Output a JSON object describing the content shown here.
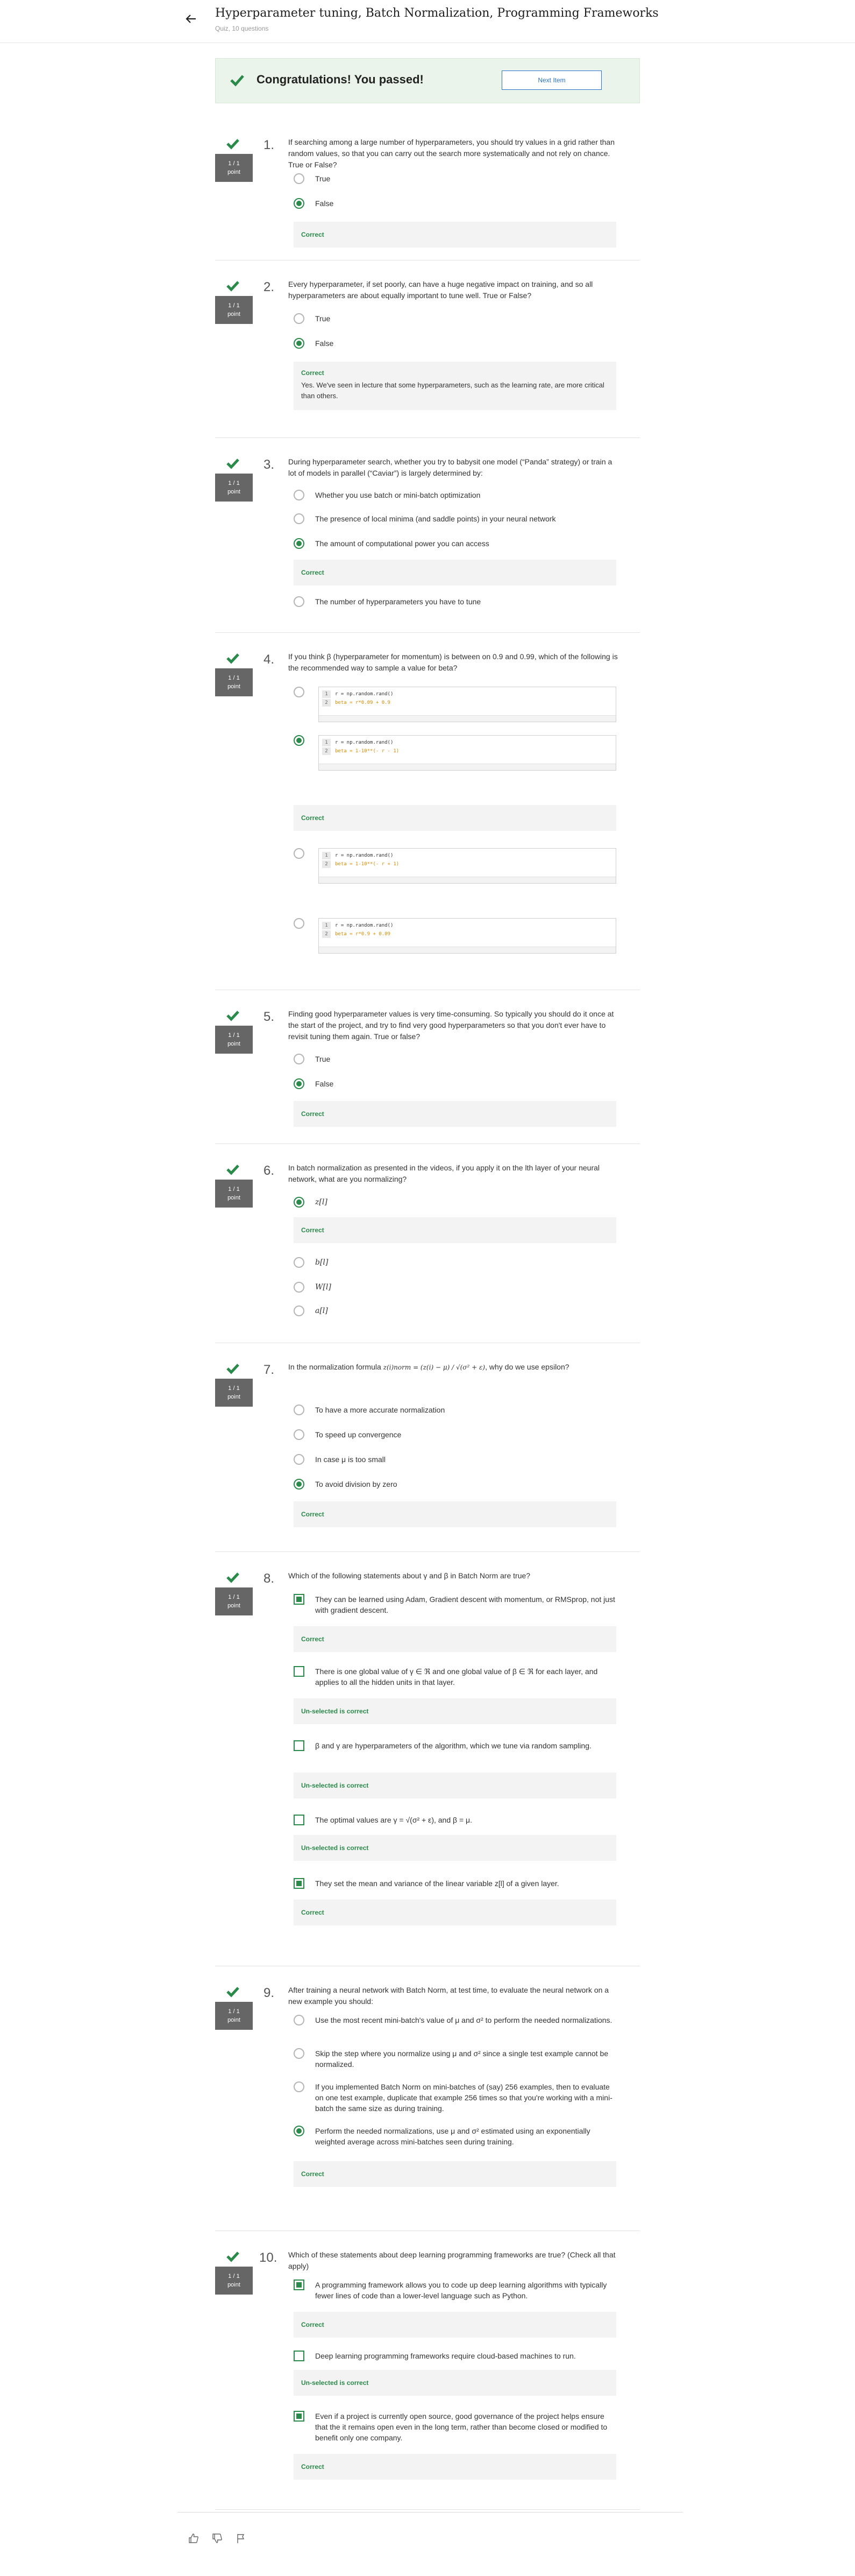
{
  "header": {
    "title": "Hyperparameter tuning, Batch Normalization, Programming Frameworks",
    "subtitle": "Quiz, 10 questions"
  },
  "banner": {
    "message": "Congratulations! You passed!",
    "next_label": "Next Item"
  },
  "points": {
    "score": "1 / 1",
    "unit": "point"
  },
  "colors": {
    "accent_green": "#2a8a4a",
    "link_blue": "#2a73cc"
  },
  "questions": [
    {
      "number": "1.",
      "text": "If searching among a large number of hyperparameters, you should try values in a grid rather than random values, so that you can carry out the search more systematically and not rely on chance. True or False?",
      "options": [
        "True",
        "False"
      ],
      "feedback": "Correct"
    },
    {
      "number": "2.",
      "text": "Every hyperparameter, if set poorly, can have a huge negative impact on training, and so all hyperparameters are about equally important to tune well. True or False?",
      "options": [
        "True",
        "False"
      ],
      "feedback": "Correct",
      "explanation": "Yes. We've seen in lecture that some hyperparameters, such as the learning rate, are more critical than others."
    },
    {
      "number": "3.",
      "text": "During hyperparameter search, whether you try to babysit one model (“Panda” strategy) or train a lot of models in parallel (“Caviar”) is largely determined by:",
      "options": [
        "Whether you use batch or mini-batch optimization",
        "The presence of local minima (and saddle points) in your neural network",
        "The amount of computational power you can access",
        "The number of hyperparameters you have to tune"
      ],
      "feedback": "Correct"
    },
    {
      "number": "4.",
      "text": "If you think β (hyperparameter for momentum) is between on 0.9 and 0.99, which of the following is the recommended way to sample a value for beta?",
      "code": [
        {
          "line1": "r = np.random.rand()",
          "line2": "beta = r*0.09 + 0.9"
        },
        {
          "line1": "r = np.random.rand()",
          "line2": "beta = 1-10**(- r - 1)"
        },
        {
          "line1": "r = np.random.rand()",
          "line2": "beta = 1-10**(- r + 1)"
        },
        {
          "line1": "r = np.random.rand()",
          "line2": "beta = r*0.9 + 0.09"
        }
      ],
      "line_numbers": [
        "1",
        "2"
      ],
      "feedback": "Correct"
    },
    {
      "number": "5.",
      "text": "Finding good hyperparameter values is very time-consuming. So typically you should do it once at the start of the project, and try to find very good hyperparameters so that you don't ever have to revisit tuning them again. True or false?",
      "options": [
        "True",
        "False"
      ],
      "feedback": "Correct"
    },
    {
      "number": "6.",
      "text": "In batch normalization as presented in the videos, if you apply it on the lth layer of your neural network, what are you normalizing?",
      "options": [
        "z[l]",
        "b[l]",
        "W[l]",
        "a[l]"
      ],
      "feedback": "Correct"
    },
    {
      "number": "7.",
      "text_before": "In the normalization formula",
      "formula": "z(i)norm = (z(i) − μ) / √(σ² + ε)",
      "text_after": ", why do we use epsilon?",
      "options": [
        "To have a more accurate normalization",
        "To speed up convergence",
        "In case μ is too small",
        "To avoid division by zero"
      ],
      "feedback": "Correct"
    },
    {
      "number": "8.",
      "text": "Which of the following statements about γ and β in Batch Norm are true?",
      "options": [
        "They can be learned using Adam, Gradient descent with momentum, or RMSprop, not just with gradient descent.",
        "There is one global value of γ ∈ ℜ and one global value of β ∈ ℜ for each layer, and applies to all the hidden units in that layer.",
        "β and γ are hyperparameters of the algorithm, which we tune via random sampling.",
        "The optimal values are γ = √(σ² + ε), and β = μ.",
        "They set the mean and variance of the linear variable z[l] of a given layer."
      ],
      "feedback": [
        "Correct",
        "Un-selected is correct",
        "Un-selected is correct",
        "Un-selected is correct",
        "Correct"
      ]
    },
    {
      "number": "9.",
      "text": "After training a neural network with Batch Norm, at test time, to evaluate the neural network on a new example you should:",
      "options": [
        "Use the most recent mini-batch's value of μ and σ² to perform the needed normalizations.",
        "Skip the step where you normalize using μ and σ² since a single test example cannot be normalized.",
        "If you implemented Batch Norm on mini-batches of (say) 256 examples, then to evaluate on one test example, duplicate that example 256 times so that you're working with a mini-batch the same size as during training.",
        "Perform the needed normalizations, use μ and σ² estimated using an exponentially weighted average across mini-batches seen during training."
      ],
      "feedback": "Correct"
    },
    {
      "number": "10.",
      "text": "Which of these statements about deep learning programming frameworks are true? (Check all that apply)",
      "options": [
        "A programming framework allows you to code up deep learning algorithms with typically fewer lines of code than a lower-level language such as Python.",
        "Deep learning programming frameworks require cloud-based machines to run.",
        "Even if a project is currently open source, good governance of the project helps ensure that the it remains open even in the long term, rather than become closed or modified to benefit only one company."
      ],
      "feedback": [
        "Correct",
        "Un-selected is correct",
        "Correct"
      ]
    }
  ],
  "footer": {
    "icons": [
      "thumbs-up-icon",
      "thumbs-down-icon",
      "flag-icon"
    ]
  }
}
